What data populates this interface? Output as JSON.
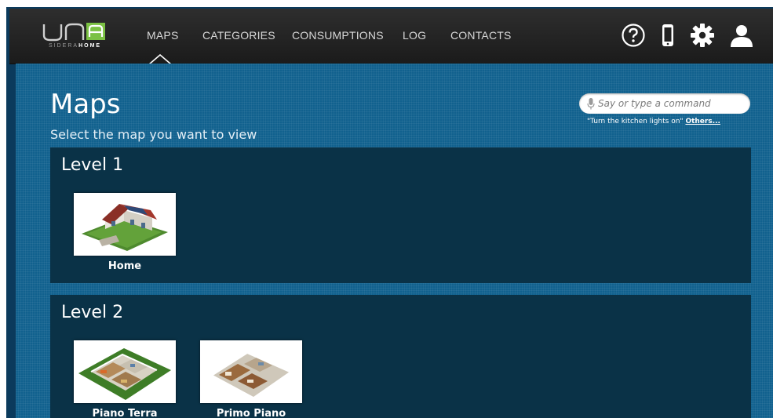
{
  "app": {
    "logo_text": "unA",
    "logo_sub_left": "SIDERA",
    "logo_sub_right": "HOME"
  },
  "nav": {
    "items": [
      {
        "label": "MAPS",
        "active": true
      },
      {
        "label": "CATEGORIES"
      },
      {
        "label": "CONSUMPTIONS"
      },
      {
        "label": "LOG"
      },
      {
        "label": "CONTACTS"
      }
    ],
    "icons": [
      "help-icon",
      "phone-icon",
      "settings-icon",
      "user-icon"
    ]
  },
  "page": {
    "title": "Maps",
    "subtitle": "Select the map you want to view"
  },
  "command": {
    "placeholder": "Say or type a command",
    "hint": "\"Turn the kitchen lights on\"",
    "hint_link": "Others..."
  },
  "levels": [
    {
      "title": "Level 1",
      "maps": [
        {
          "label": "Home"
        }
      ]
    },
    {
      "title": "Level 2",
      "maps": [
        {
          "label": "Piano Terra"
        },
        {
          "label": "Primo Piano"
        }
      ]
    }
  ],
  "colors": {
    "accent": "#7bc143",
    "background": "#11618e",
    "panel": "#0a3247",
    "navbar": "#242424"
  }
}
